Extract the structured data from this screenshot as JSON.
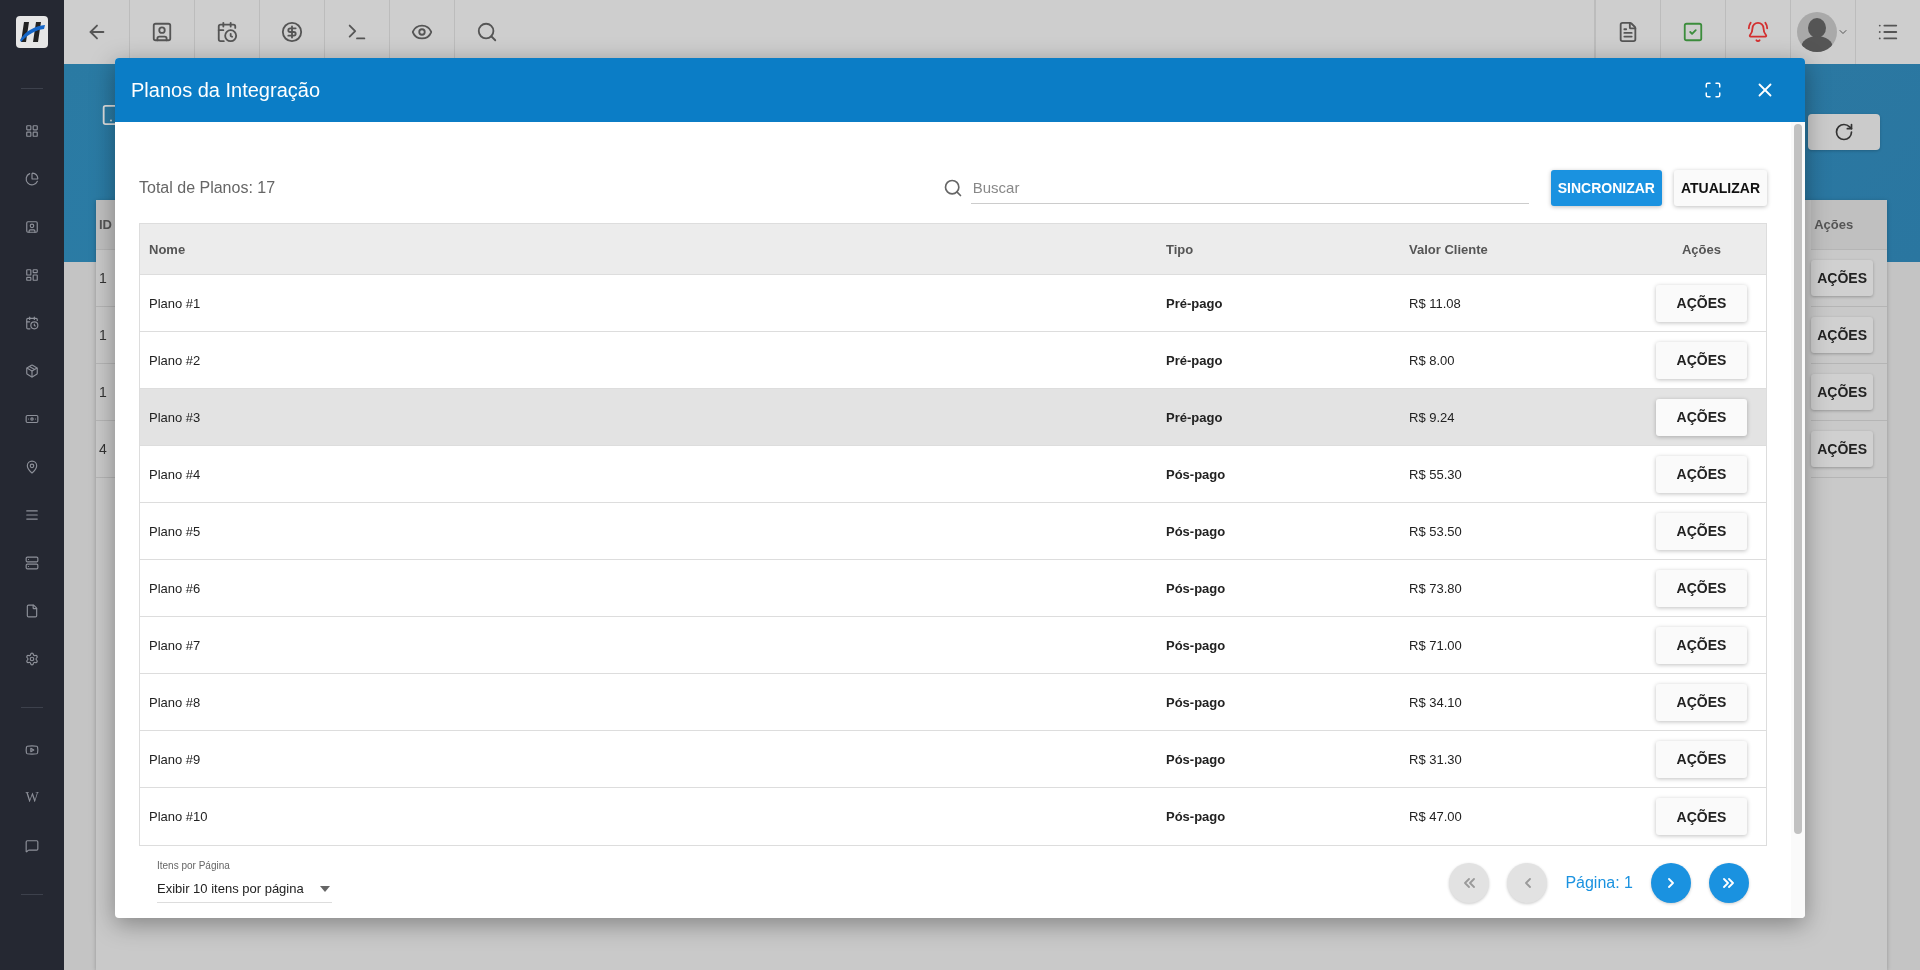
{
  "sidebar": {
    "wiki_glyph": "W"
  },
  "background": {
    "id_header": "ID",
    "ids": [
      "1",
      "1",
      "1",
      "4"
    ],
    "actions_header": "Ações",
    "action_buttons": [
      "AÇÕES",
      "AÇÕES",
      "AÇÕES",
      "AÇÕES"
    ]
  },
  "modal": {
    "title": "Planos da Integração",
    "total": "Total de Planos: 17",
    "search": {
      "placeholder": "Buscar"
    },
    "buttons": [
      {
        "label": "SINCRONIZAR",
        "kind": "primary"
      },
      {
        "label": "ATUALIZAR",
        "kind": "default"
      }
    ],
    "table": {
      "columns": [
        "Nome",
        "Tipo",
        "Valor Cliente",
        "Ações"
      ],
      "rows": [
        {
          "name": "Plano #1",
          "type": "Pré-pago",
          "value": "R$ 11.08",
          "action": "AÇÕES",
          "highlighted": false
        },
        {
          "name": "Plano #2",
          "type": "Pré-pago",
          "value": "R$ 8.00",
          "action": "AÇÕES",
          "highlighted": false
        },
        {
          "name": "Plano #3",
          "type": "Pré-pago",
          "value": "R$ 9.24",
          "action": "AÇÕES",
          "highlighted": true
        },
        {
          "name": "Plano #4",
          "type": "Pós-pago",
          "value": "R$ 55.30",
          "action": "AÇÕES",
          "highlighted": false
        },
        {
          "name": "Plano #5",
          "type": "Pós-pago",
          "value": "R$ 53.50",
          "action": "AÇÕES",
          "highlighted": false
        },
        {
          "name": "Plano #6",
          "type": "Pós-pago",
          "value": "R$ 73.80",
          "action": "AÇÕES",
          "highlighted": false
        },
        {
          "name": "Plano #7",
          "type": "Pós-pago",
          "value": "R$ 71.00",
          "action": "AÇÕES",
          "highlighted": false
        },
        {
          "name": "Plano #8",
          "type": "Pós-pago",
          "value": "R$ 34.10",
          "action": "AÇÕES",
          "highlighted": false
        },
        {
          "name": "Plano #9",
          "type": "Pós-pago",
          "value": "R$ 31.30",
          "action": "AÇÕES",
          "highlighted": false
        },
        {
          "name": "Plano #10",
          "type": "Pós-pago",
          "value": "R$ 47.00",
          "action": "AÇÕES",
          "highlighted": false
        }
      ]
    },
    "pagination": {
      "per_page_label": "Itens por Página",
      "per_page_value": "Exibir 10 itens por página",
      "page": "Página: 1",
      "buttons": [
        {
          "kind": "first",
          "disabled": true
        },
        {
          "kind": "prev",
          "disabled": true
        },
        {
          "kind": "next",
          "disabled": false
        },
        {
          "kind": "last",
          "disabled": false
        }
      ]
    }
  }
}
